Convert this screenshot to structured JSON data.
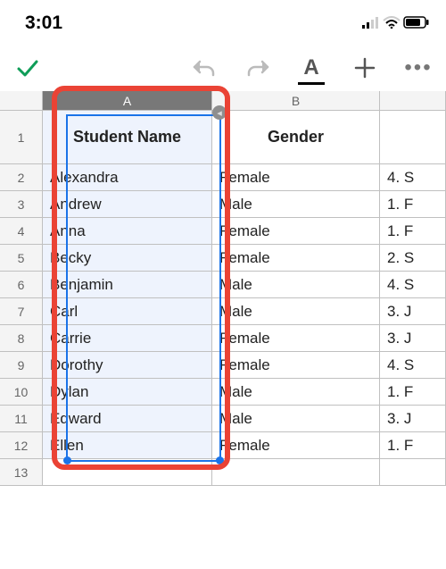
{
  "status": {
    "time": "3:01"
  },
  "toolbar": {
    "confirm": "confirm",
    "undo": "undo",
    "redo": "redo",
    "text_format": "A",
    "insert": "insert",
    "more": "•••"
  },
  "columns": {
    "A": "A",
    "B": "B",
    "C": ""
  },
  "headers": {
    "A": "Student Name",
    "B": "Gender"
  },
  "rows": [
    {
      "n": "1"
    },
    {
      "n": "2",
      "a": "Alexandra",
      "b": "Female",
      "c": "4. S"
    },
    {
      "n": "3",
      "a": "Andrew",
      "b": "Male",
      "c": "1. F"
    },
    {
      "n": "4",
      "a": "Anna",
      "b": "Female",
      "c": "1. F"
    },
    {
      "n": "5",
      "a": "Becky",
      "b": "Female",
      "c": "2. S"
    },
    {
      "n": "6",
      "a": "Benjamin",
      "b": "Male",
      "c": "4. S"
    },
    {
      "n": "7",
      "a": "Carl",
      "b": "Male",
      "c": "3. J"
    },
    {
      "n": "8",
      "a": "Carrie",
      "b": "Female",
      "c": "3. J"
    },
    {
      "n": "9",
      "a": "Dorothy",
      "b": "Female",
      "c": "4. S"
    },
    {
      "n": "10",
      "a": "Dylan",
      "b": "Male",
      "c": "1. F"
    },
    {
      "n": "11",
      "a": "Edward",
      "b": "Male",
      "c": "3. J"
    },
    {
      "n": "12",
      "a": "Ellen",
      "b": "Female",
      "c": "1. F"
    },
    {
      "n": "13"
    }
  ]
}
